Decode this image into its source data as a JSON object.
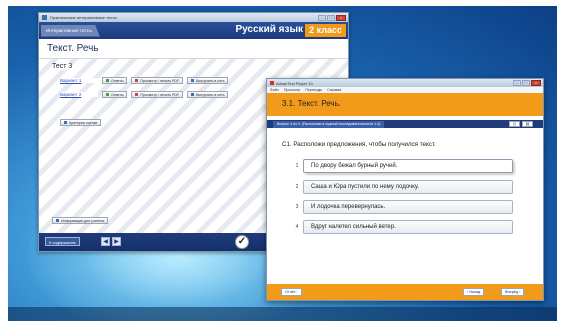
{
  "window1": {
    "title": "Практические интерактивные тесты",
    "tab": "Интерактивные тесты",
    "subject": "Русский язык",
    "grade": "2 класс",
    "page_title": "Текст. Речь",
    "test_label": "Тест 3",
    "variants": [
      {
        "label": "Вариант 1",
        "answer": "Ответы",
        "print": "Просмотр / печать PDF",
        "upload": "Выгрузить в сеть"
      },
      {
        "label": "Вариант 2",
        "answer": "Ответы",
        "print": "Просмотр / печать PDF",
        "upload": "Выгрузить в сеть"
      }
    ],
    "criteria": "Критерии оценки",
    "teacher_info": "Информация для учителя",
    "contents": "К содержанию"
  },
  "window2": {
    "title": "AdvanTest Player 10",
    "menu": [
      "Файл",
      "Просмотр",
      "Переходы",
      "Справка"
    ],
    "heading": "3.1. Текст. Речь.",
    "question_tab": "Вопрос 4 из 4. (Расположи в нужной последовательности 1-4)",
    "question": "С1. Расположи предложения, чтобы получился текст.",
    "options": [
      {
        "num": "1",
        "text": "По двору бежал бурный ручей."
      },
      {
        "num": "2",
        "text": "Саша и Юра пустили по нему лодочку."
      },
      {
        "num": "3",
        "text": "И лодочка перевернулась."
      },
      {
        "num": "4",
        "text": "Вдруг налетел сильный ветер."
      }
    ],
    "finish": "Отчёт...",
    "prev": "‹ Назад",
    "next": "Вперёд ›"
  }
}
